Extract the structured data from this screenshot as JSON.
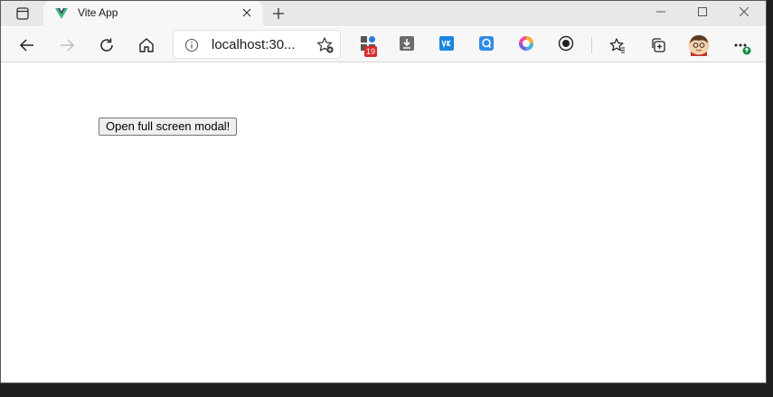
{
  "browser": {
    "tab": {
      "title": "Vite App",
      "favicon": "vue-logo-icon"
    },
    "address_bar": {
      "url": "localhost:30..."
    },
    "extensions": [
      {
        "name": "apps-extension-icon",
        "badge": "19"
      },
      {
        "name": "download-extension-icon"
      },
      {
        "name": "vk-extension-icon"
      },
      {
        "name": "q-extension-icon"
      },
      {
        "name": "color-wheel-extension-icon"
      },
      {
        "name": "record-extension-icon"
      }
    ]
  },
  "page": {
    "button_label": "Open full screen modal!"
  },
  "colors": {
    "tab_bar": "#e8e8e8",
    "toolbar": "#f7f7f7",
    "badge": "#d72b2b",
    "vue_green": "#41b883"
  }
}
